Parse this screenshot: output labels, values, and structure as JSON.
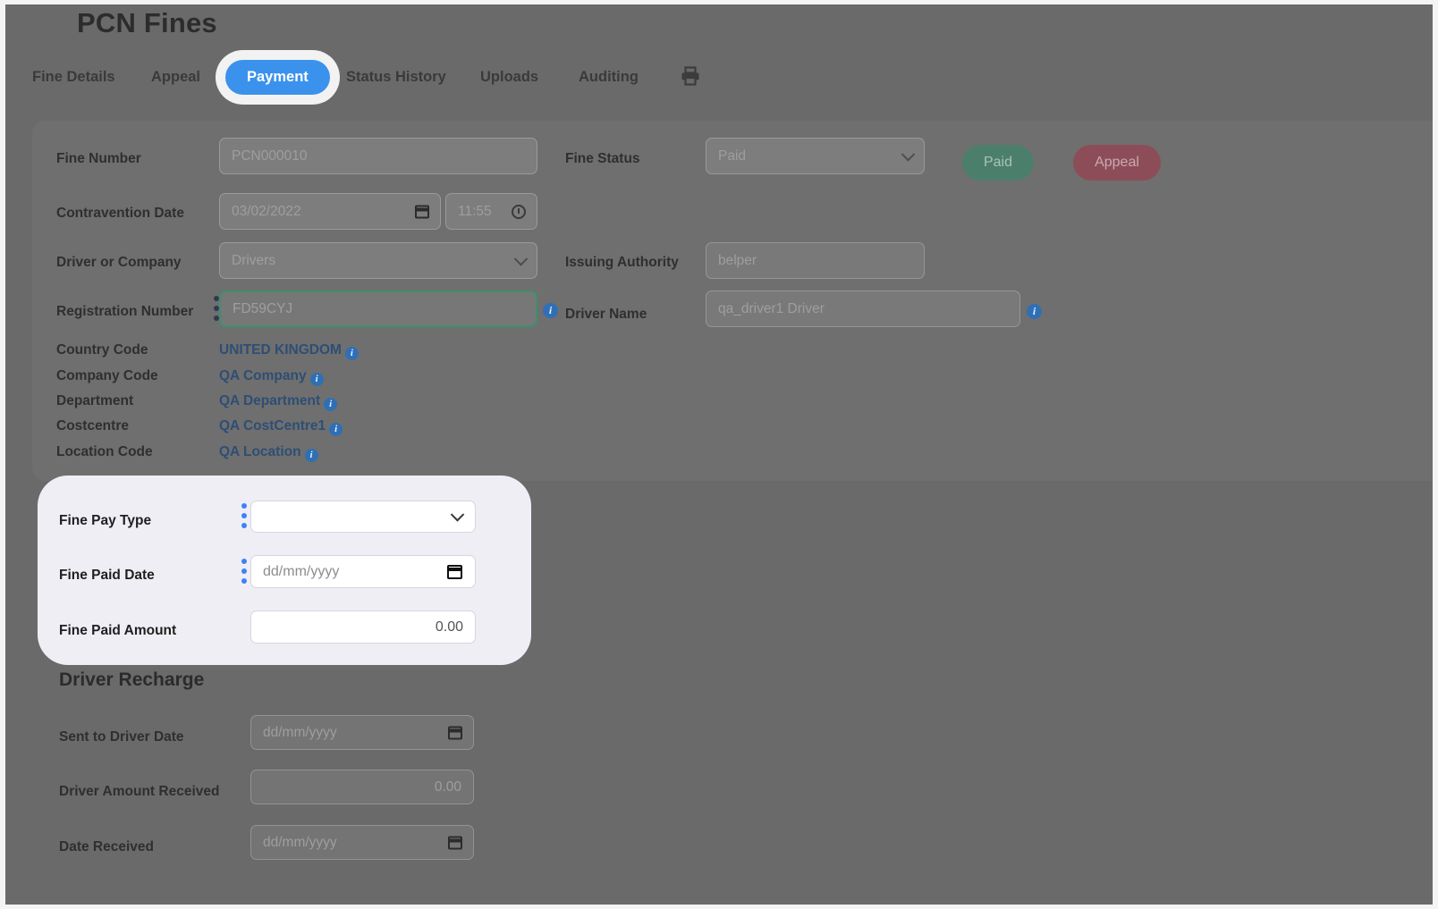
{
  "header": {
    "title": "PCN Fines",
    "tabs": [
      {
        "label": "Fine Details",
        "active": false
      },
      {
        "label": "Appeal",
        "active": false
      },
      {
        "label": "Payment",
        "active": true
      },
      {
        "label": "Status History",
        "active": false
      },
      {
        "label": "Uploads",
        "active": false
      },
      {
        "label": "Auditing",
        "active": false
      }
    ],
    "print_icon": "printer-icon"
  },
  "colors": {
    "accent_blue": "#3b92ec",
    "link_blue": "#2e4e74",
    "info_badge": "#2f6fb5",
    "handle_blue": "#3b82f6",
    "paid_green": "#4b7f6c",
    "appeal_red": "#8d4d58",
    "focus_green": "#3e8f6b",
    "spotlight_bg": "#f0eef5",
    "dim_backdrop": "#6a6a6a"
  },
  "fine_details": {
    "fine_number": {
      "label": "Fine Number",
      "value": "PCN000010"
    },
    "contravention_date": {
      "label": "Contravention Date",
      "date_value": "03/02/2022",
      "time_value": "11:55"
    },
    "driver_or_company": {
      "label": "Driver or Company",
      "value": "Drivers"
    },
    "registration_number": {
      "label": "Registration Number",
      "value": "FD59CYJ"
    },
    "fine_status": {
      "label": "Fine Status",
      "value": "Paid"
    },
    "issuing_authority": {
      "label": "Issuing Authority",
      "value": "belper"
    },
    "driver_name": {
      "label": "Driver Name",
      "value": "qa_driver1 Driver"
    },
    "status_buttons": [
      {
        "label": "Paid",
        "name": "paid-button"
      },
      {
        "label": "Appeal",
        "name": "appeal-button"
      }
    ],
    "link_rows": [
      {
        "label": "Country Code",
        "value": "UNITED KINGDOM"
      },
      {
        "label": "Company Code",
        "value": "QA Company"
      },
      {
        "label": "Department",
        "value": "QA Department"
      },
      {
        "label": "Costcentre",
        "value": "QA CostCentre1"
      },
      {
        "label": "Location Code",
        "value": "QA Location"
      }
    ]
  },
  "payment_panel": {
    "fine_pay_type": {
      "label": "Fine Pay Type",
      "value": ""
    },
    "fine_paid_date": {
      "label": "Fine Paid Date",
      "placeholder": "dd/mm/yyyy"
    },
    "fine_paid_amount": {
      "label": "Fine Paid Amount",
      "value": "0.00"
    }
  },
  "driver_recharge": {
    "title": "Driver Recharge",
    "sent_to_driver_date": {
      "label": "Sent to Driver Date",
      "placeholder": "dd/mm/yyyy"
    },
    "driver_amount_received": {
      "label": "Driver Amount Received",
      "value": "0.00"
    },
    "date_received": {
      "label": "Date Received",
      "placeholder": "dd/mm/yyyy"
    }
  },
  "icons": {
    "info": "i",
    "calendar": "calendar-icon",
    "clock": "clock-icon",
    "chevron": "chevron-down-icon"
  }
}
